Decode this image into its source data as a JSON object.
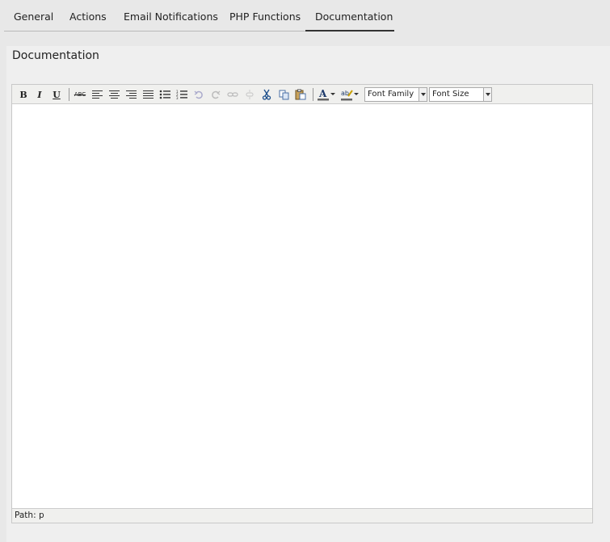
{
  "tabs": [
    {
      "label": "General"
    },
    {
      "label": "Actions"
    },
    {
      "label": "Email Notifications"
    },
    {
      "label": "PHP Functions"
    },
    {
      "label": "Documentation",
      "active": true
    }
  ],
  "section_title": "Documentation",
  "editor": {
    "toolbar": {
      "bold": "B",
      "italic": "I",
      "underline": "U",
      "strikethrough": "ABC",
      "font_family": "Font Family",
      "font_size": "Font Size"
    },
    "status_path": "Path: p"
  }
}
